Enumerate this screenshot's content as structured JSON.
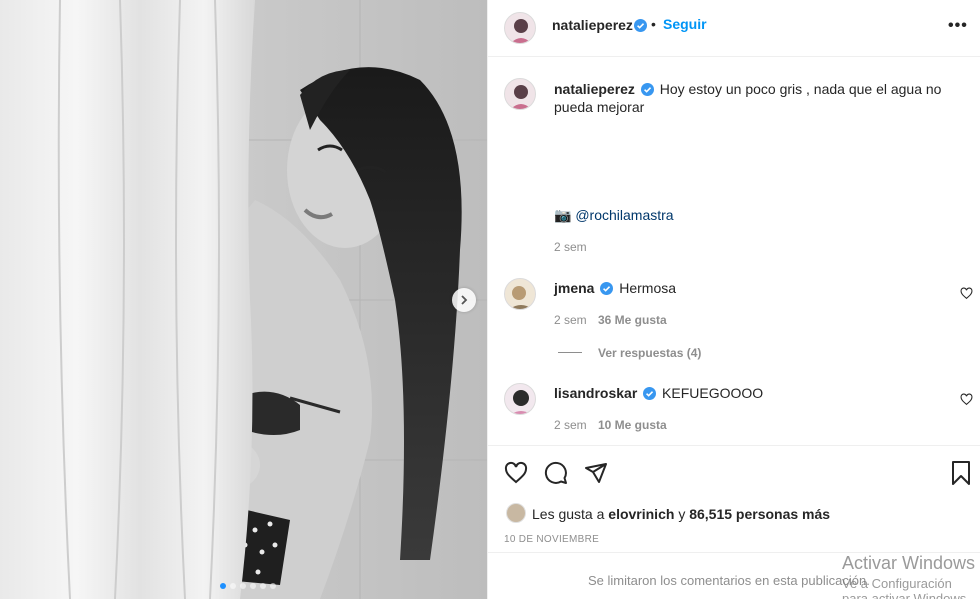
{
  "post": {
    "author": "natalieperez",
    "follow_label": "Seguir",
    "bullet": "•",
    "more": "•••",
    "caption": "Hoy estoy un poco gris , nada que el agua no pueda mejorar",
    "credit_emoji": "📷",
    "credit_mention": "@rochilamastra",
    "caption_age": "2 sem"
  },
  "comments": [
    {
      "user": "jmena",
      "text": "Hermosa",
      "age": "2 sem",
      "likes": "36 Me gusta"
    },
    {
      "user": "lisandroskar",
      "text": "KEFUEGOOOO",
      "age": "2 sem",
      "likes": "10 Me gusta"
    }
  ],
  "replies_label": "Ver respuestas (4)",
  "likes": {
    "prefix": "Les gusta a",
    "user": "elovrinich",
    "joiner": "y",
    "count": "86,515 personas más"
  },
  "date": "10 DE NOVIEMBRE",
  "comments_disabled": "Se limitaron los comentarios en esta publicación.",
  "carousel": {
    "count": 6,
    "active": 0
  },
  "watermark": {
    "line1": "Activar Windows",
    "line2": "Ve a Configuración para activar Windows."
  },
  "colors": {
    "accent": "#0095f6",
    "verified": "#3897f0",
    "muted": "#8e8e8e",
    "text": "#262626"
  },
  "icons": [
    "heart-icon",
    "comment-icon",
    "share-icon",
    "bookmark-icon",
    "verified-icon",
    "chevron-right-icon"
  ]
}
